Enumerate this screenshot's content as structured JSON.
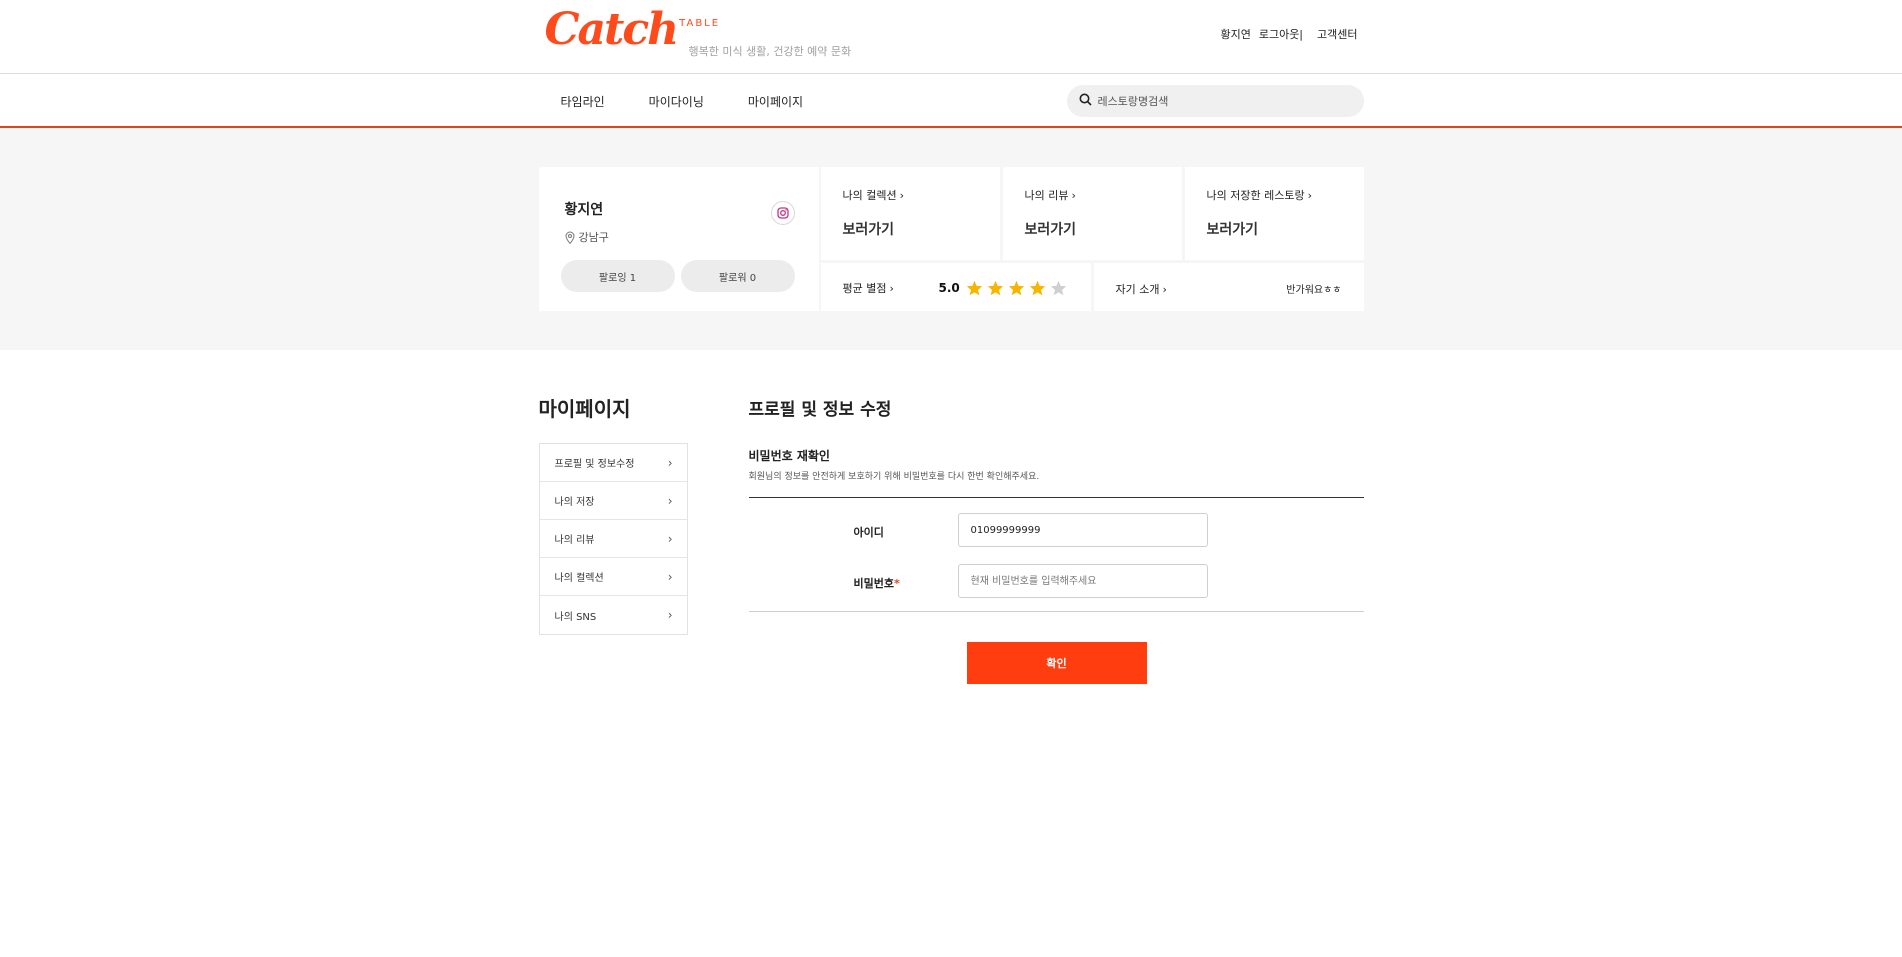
{
  "header": {
    "logo_main": "Catch",
    "logo_sub": "TABLE",
    "tagline": "행복한 미식 생활, 건강한 예약 문화",
    "user_name": "황지연",
    "logout": "로그아웃|",
    "help_center": "고객센터"
  },
  "nav": {
    "items": [
      {
        "label": "타임라인"
      },
      {
        "label": "마이다이닝"
      },
      {
        "label": "마이페이지"
      }
    ],
    "search_placeholder": "레스토랑명검색"
  },
  "profile": {
    "name": "황지연",
    "location": "강남구",
    "following": "팔로잉 1",
    "followers": "팔로워 0",
    "instagram_icon": "instagram-icon",
    "links": [
      {
        "title": "나의 컬렉션",
        "value": "보러가기"
      },
      {
        "title": "나의 리뷰",
        "value": "보러가기"
      },
      {
        "title": "나의 저장한 레스토랑",
        "value": "보러가기"
      }
    ],
    "rating": {
      "label": "평균 별점",
      "value": "5.0",
      "stars_filled": 4,
      "stars_total": 5
    },
    "intro": {
      "label": "자기 소개",
      "text": "반가워요ㅎㅎ"
    }
  },
  "sidebar": {
    "title": "마이페이지",
    "items": [
      {
        "label": "프로필 및 정보수정"
      },
      {
        "label": "나의 저장"
      },
      {
        "label": "나의 리뷰"
      },
      {
        "label": "나의 컬렉션"
      },
      {
        "label": "나의 SNS"
      }
    ]
  },
  "main": {
    "title": "프로필 및 정보 수정",
    "section_title": "비밀번호 재확인",
    "section_desc": "회원님의 정보를 안전하게 보호하기 위해 비밀번호를 다시 한번 확인해주세요.",
    "id_label": "아이디",
    "id_value": "01099999999",
    "password_label": "비밀번호",
    "password_required_mark": "*",
    "password_placeholder": "현재 비밀번호를 입력해주세요",
    "confirm_label": "확인"
  },
  "colors": {
    "brand": "#ff4a1c",
    "confirm_button": "#ff3d0f",
    "nav_underline": "#e0461d",
    "star_filled": "#f7b500",
    "star_empty": "#cfcfcf"
  }
}
